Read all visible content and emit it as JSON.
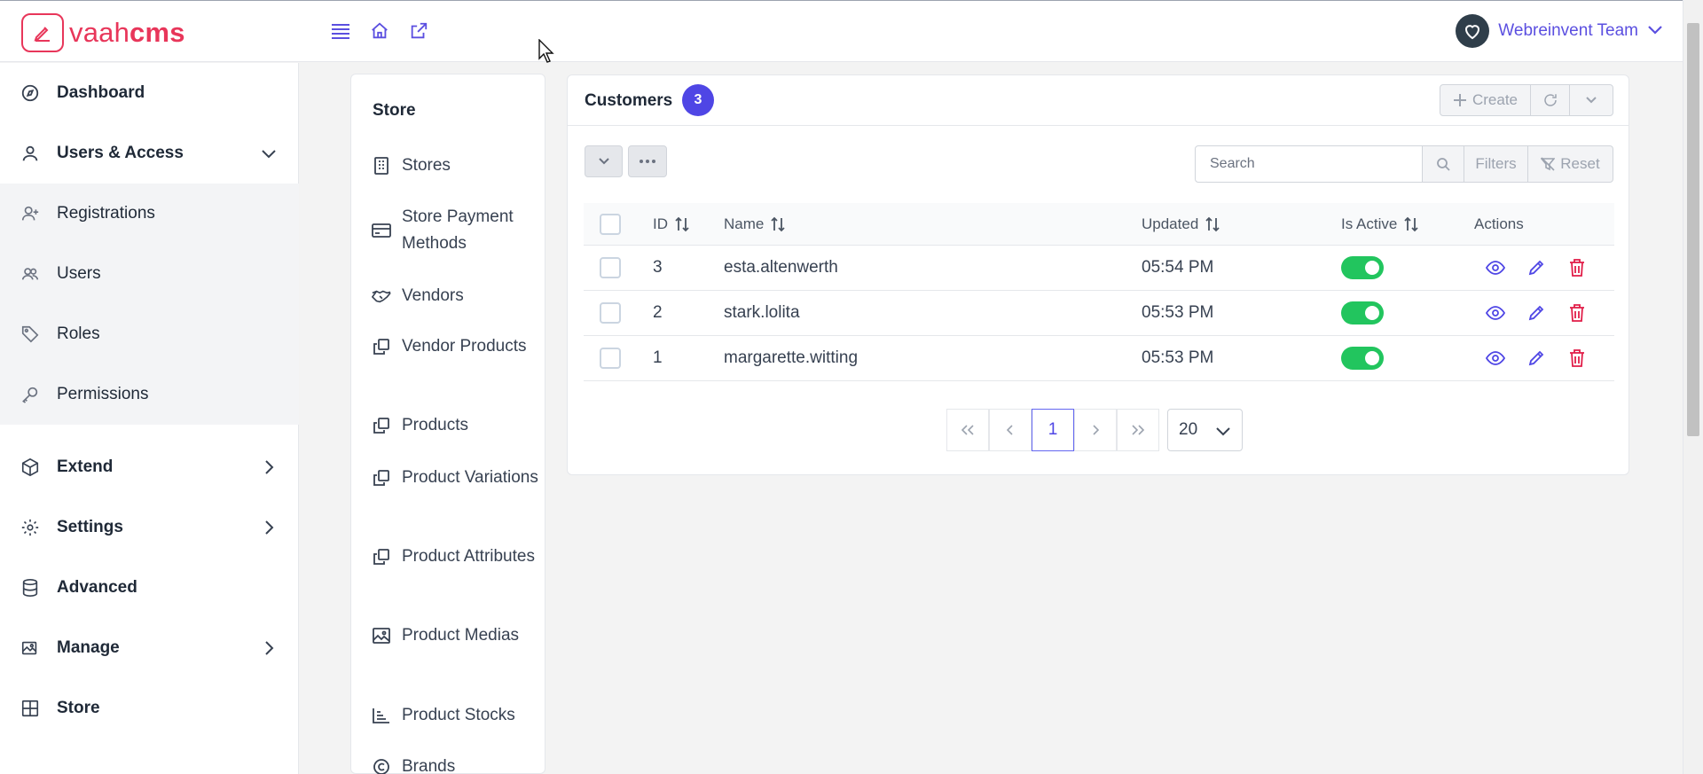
{
  "app": {
    "logo_text_light": "vaah",
    "logo_text_bold": "cms",
    "brand_color": "#e8365a",
    "accent_color": "#4f46e5",
    "user_name": "Webreinvent Team"
  },
  "topbar": {
    "icons": [
      "menu-icon",
      "home-icon",
      "external-link-icon"
    ]
  },
  "sidebar": {
    "items": [
      {
        "label": "Dashboard",
        "icon": "compass-icon"
      },
      {
        "label": "Users & Access",
        "icon": "user-icon",
        "expanded": true
      },
      {
        "label": "Registrations",
        "icon": "user-plus-icon"
      },
      {
        "label": "Users",
        "icon": "users-icon"
      },
      {
        "label": "Roles",
        "icon": "tag-icon"
      },
      {
        "label": "Permissions",
        "icon": "key-icon"
      },
      {
        "label": "Extend",
        "icon": "box-icon"
      },
      {
        "label": "Settings",
        "icon": "gear-icon"
      },
      {
        "label": "Advanced",
        "icon": "database-icon"
      },
      {
        "label": "Manage",
        "icon": "images-icon"
      },
      {
        "label": "Store",
        "icon": "table-icon"
      }
    ]
  },
  "submenu": {
    "title": "Store",
    "items": [
      {
        "label": "Stores",
        "icon": "building-icon"
      },
      {
        "label": "Store Payment Methods",
        "icon": "credit-card-icon"
      },
      {
        "label": "Vendors",
        "icon": "handshake-icon"
      },
      {
        "label": "Vendor Products",
        "icon": "clone-icon"
      },
      {
        "label": "Products",
        "icon": "clone-icon"
      },
      {
        "label": "Product Variations",
        "icon": "clone-icon"
      },
      {
        "label": "Product Attributes",
        "icon": "clone-icon"
      },
      {
        "label": "Product Medias",
        "icon": "image-icon"
      },
      {
        "label": "Product Stocks",
        "icon": "chart-bar-icon"
      },
      {
        "label": "Brands",
        "icon": "copyright-icon"
      }
    ]
  },
  "customers": {
    "title": "Customers",
    "count": "3",
    "create_label": "Create",
    "search_placeholder": "Search",
    "filters_label": "Filters",
    "reset_label": "Reset",
    "columns": [
      "ID",
      "Name",
      "Updated",
      "Is Active",
      "Actions"
    ],
    "rows": [
      {
        "id": "3",
        "name": "esta.altenwerth",
        "updated": "05:54 PM",
        "is_active": true
      },
      {
        "id": "2",
        "name": "stark.lolita",
        "updated": "05:53 PM",
        "is_active": true
      },
      {
        "id": "1",
        "name": "margarette.witting",
        "updated": "05:53 PM",
        "is_active": true
      }
    ],
    "pagination": {
      "current_page": "1",
      "rows_per_page": "20"
    }
  }
}
